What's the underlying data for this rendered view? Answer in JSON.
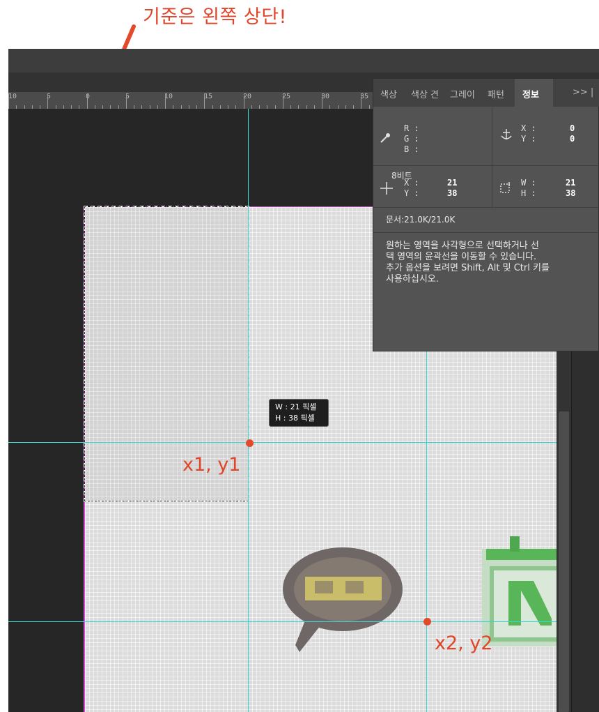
{
  "annotation": {
    "title": "기준은 왼쪽 상단!",
    "point1_label": "x1, y1",
    "point2_label": "x2, y2",
    "color": "#e34a2a"
  },
  "ruler": {
    "labels": [
      "10",
      "5",
      "0",
      "5",
      "10",
      "15",
      "20",
      "25",
      "30",
      "35"
    ]
  },
  "panel": {
    "tabs": [
      "색상",
      "색상 견",
      "그레이",
      "패턴",
      "정보",
      ">> |"
    ],
    "active_tab": "정보",
    "rgb": {
      "r_label": "R :",
      "g_label": "G :",
      "b_label": "B :"
    },
    "bit_depth": "8비트",
    "anchor": {
      "x_label": "X :",
      "y_label": "Y :",
      "x": "0",
      "y": "0"
    },
    "cursor": {
      "x_label": "X :",
      "y_label": "Y :",
      "x": "21",
      "y": "38"
    },
    "size": {
      "w_label": "W :",
      "h_label": "H :",
      "w": "21",
      "h": "38"
    },
    "document": "문서:21.0K/21.0K",
    "help_lines": [
      "원하는 영역을 사각형으로 선택하거나 선",
      "택 영역의 윤곽선을 이동할 수 있습니다.",
      "추가 옵션을 보려면 Shift, Alt 및 Ctrl 키를",
      "사용하십시오."
    ]
  },
  "tooltip": {
    "w_line": "W : 21 픽셀",
    "h_line": "H : 38 픽셀"
  },
  "colors": {
    "guide": "#35d7d7",
    "canvas_border": "#d24bd2",
    "panel_bg": "#535353"
  }
}
